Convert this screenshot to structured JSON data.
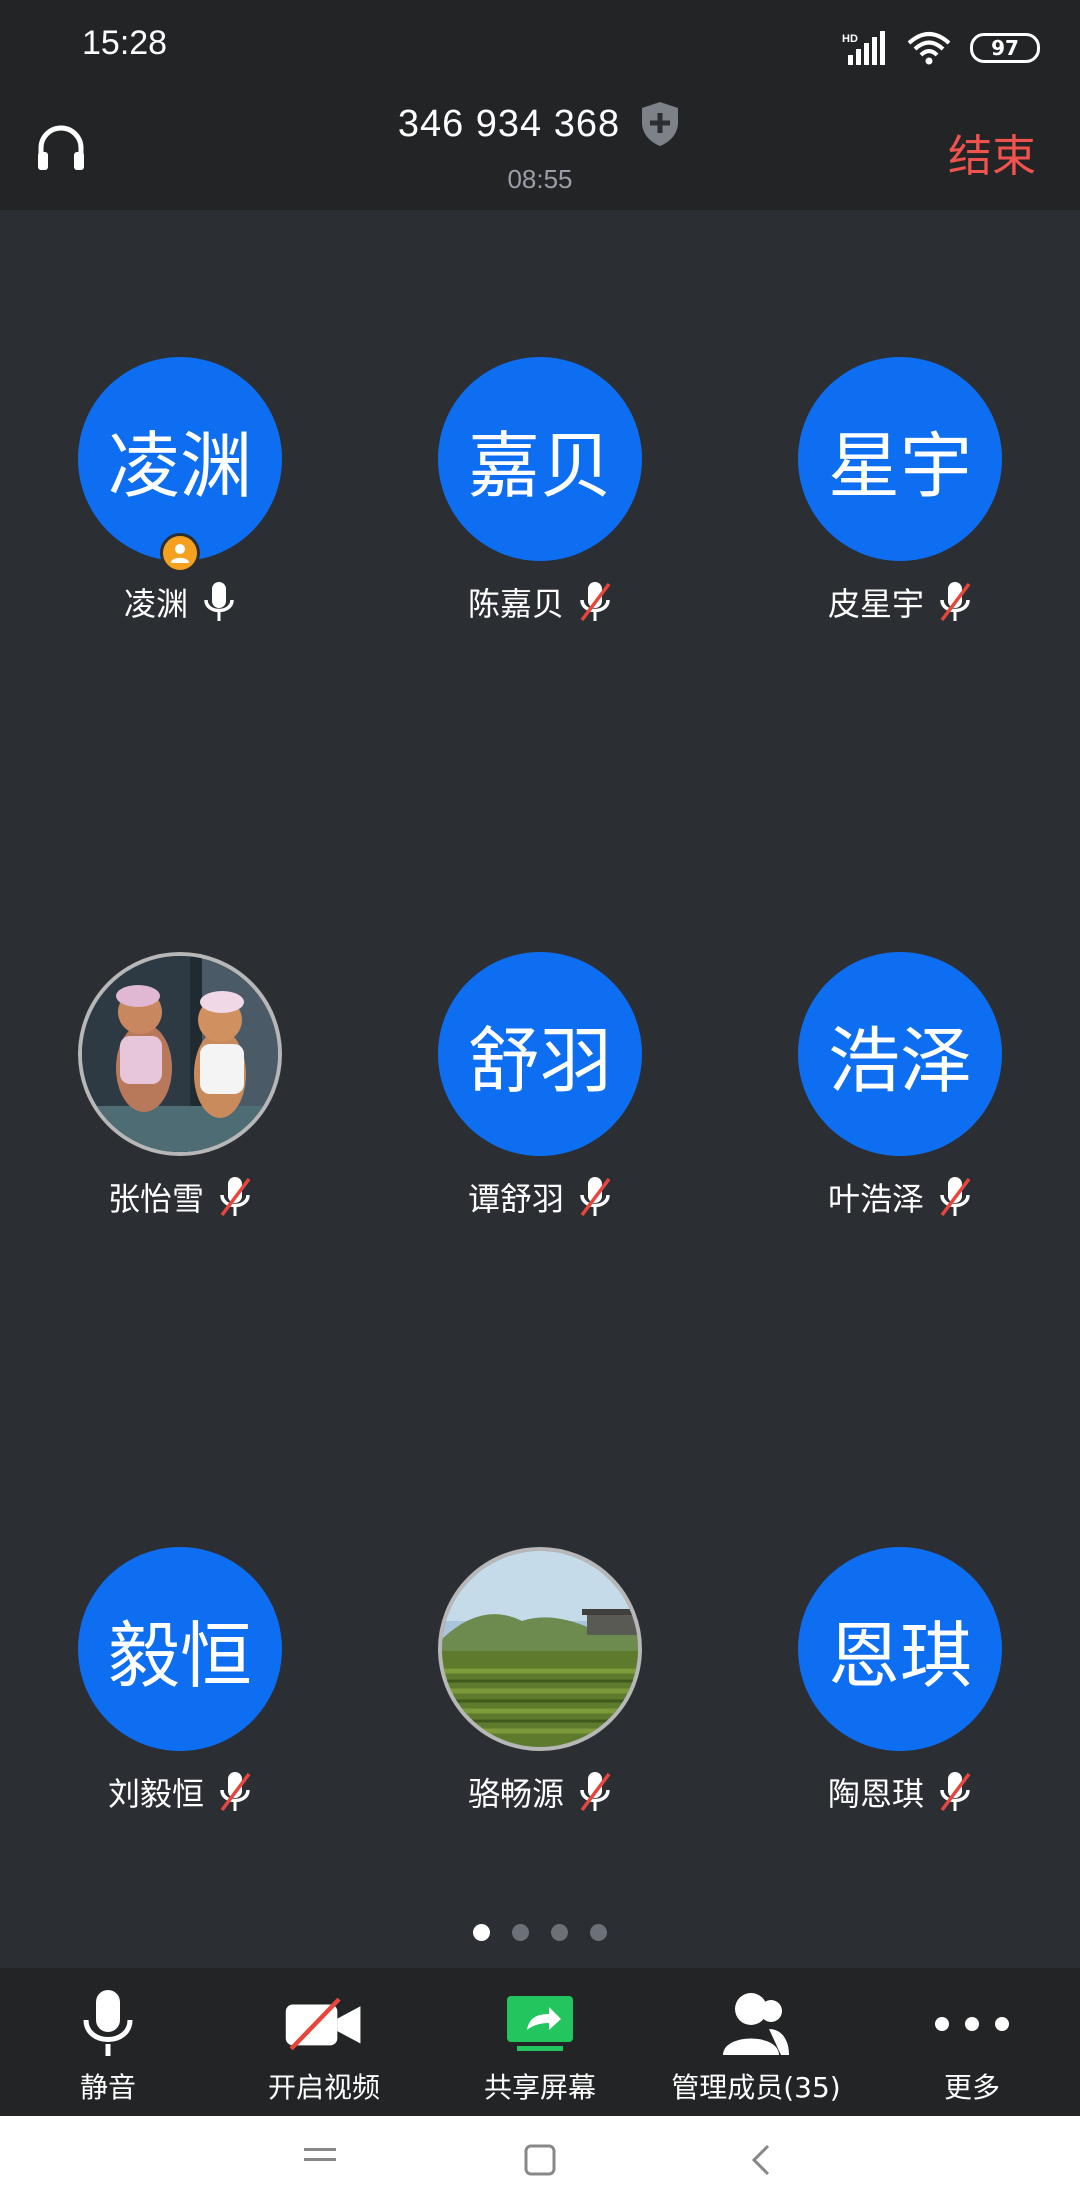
{
  "status_bar": {
    "time": "15:28",
    "network": "HD",
    "battery": "97"
  },
  "header": {
    "meeting_id": "346 934 368",
    "timer": "08:55",
    "end_label": "结束",
    "icons": [
      "headset-icon",
      "shield-plus-icon"
    ]
  },
  "participants": [
    {
      "avatar_text": "凌渊",
      "name": "凌渊",
      "mic": "on",
      "host": true
    },
    {
      "avatar_text": "嘉贝",
      "name": "陈嘉贝",
      "mic": "muted"
    },
    {
      "avatar_text": "星宇",
      "name": "皮星宇",
      "mic": "muted"
    },
    {
      "avatar_text": "",
      "name": "张怡雪",
      "mic": "muted",
      "photo": "cartoon-bears"
    },
    {
      "avatar_text": "舒羽",
      "name": "谭舒羽",
      "mic": "muted"
    },
    {
      "avatar_text": "浩泽",
      "name": "叶浩泽",
      "mic": "muted"
    },
    {
      "avatar_text": "毅恒",
      "name": "刘毅恒",
      "mic": "muted"
    },
    {
      "avatar_text": "",
      "name": "骆畅源",
      "mic": "muted",
      "photo": "tea-field"
    },
    {
      "avatar_text": "恩琪",
      "name": "陶恩琪",
      "mic": "muted"
    }
  ],
  "pager": {
    "pages": 4,
    "active": 1
  },
  "toolbar": {
    "mute": "静音",
    "video": "开启视频",
    "share": "共享屏幕",
    "members": "管理成员(35)",
    "more": "更多"
  },
  "colors": {
    "background": "#2b2e33",
    "bar": "#222426",
    "avatar_blue": "#0e6ef2",
    "end_red": "#f0524e",
    "share_green": "#22c55e",
    "host_orange": "#f5a01f"
  }
}
